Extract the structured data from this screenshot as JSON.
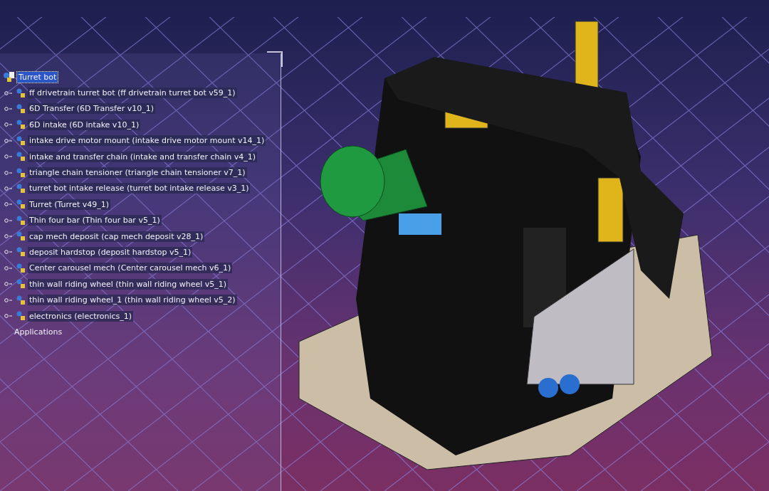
{
  "tree": {
    "root": {
      "label": "Turret bot",
      "selected": true
    },
    "children": [
      {
        "label": "ff drivetrain turret bot (ff drivetrain turret bot v59_1)",
        "selected": false
      },
      {
        "label": "6D Transfer (6D Transfer v10_1)",
        "selected": false
      },
      {
        "label": "6D intake (6D intake v10_1)",
        "selected": false
      },
      {
        "label": "intake drive motor mount (intake drive motor mount v14_1)",
        "selected": false
      },
      {
        "label": "intake and transfer chain (intake and transfer chain v4_1)",
        "selected": false
      },
      {
        "label": "triangle chain tensioner (triangle chain tensioner v7_1)",
        "selected": false
      },
      {
        "label": "turret bot intake release (turret bot intake release v3_1)",
        "selected": false
      },
      {
        "label": "Turret (Turret v49_1)",
        "selected": false
      },
      {
        "label": "Thin four bar (Thin four bar v5_1)",
        "selected": false
      },
      {
        "label": "cap mech deposit (cap mech deposit v28_1)",
        "selected": false
      },
      {
        "label": "deposit hardstop (deposit hardstop v5_1)",
        "selected": false
      },
      {
        "label": "Center carousel mech (Center carousel mech v6_1)",
        "selected": false
      },
      {
        "label": "thin wall riding wheel (thin wall riding wheel v5_1)",
        "selected": false
      },
      {
        "label": "thin wall riding wheel_1 (thin wall riding wheel v5_2)",
        "selected": false
      },
      {
        "label": "electronics (electronics_1)",
        "selected": false
      }
    ],
    "applications": {
      "label": "Applications"
    }
  }
}
